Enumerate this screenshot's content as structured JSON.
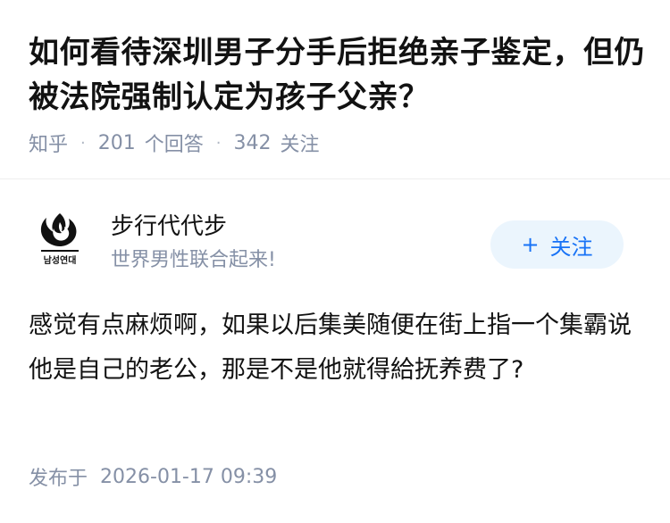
{
  "question": {
    "title": "如何看待深圳男子分手后拒绝亲子鉴定，但仍被法院强制认定为孩子父亲？",
    "source": "知乎",
    "answer_count": "201",
    "answer_label": "个回答",
    "follower_count": "342",
    "follower_label": "关注",
    "separator": "·"
  },
  "author": {
    "name": "步行代代步",
    "bio": "世界男性联合起来!",
    "avatar_icon": "emblem-avatar-icon",
    "avatar_caption": "남성연대",
    "follow_plus": "+",
    "follow_label": "关注"
  },
  "answer": {
    "content": "感觉有点麻烦啊，如果以后集美随便在街上指一个集霸说他是自己的老公，那是不是他就得給抚养费了?",
    "publish_label": "发布于",
    "publish_time": "2026-01-17 09:39"
  },
  "colors": {
    "meta": "#8590a6",
    "follow_bg": "#ebf5fd",
    "follow_text": "#1772f6"
  }
}
